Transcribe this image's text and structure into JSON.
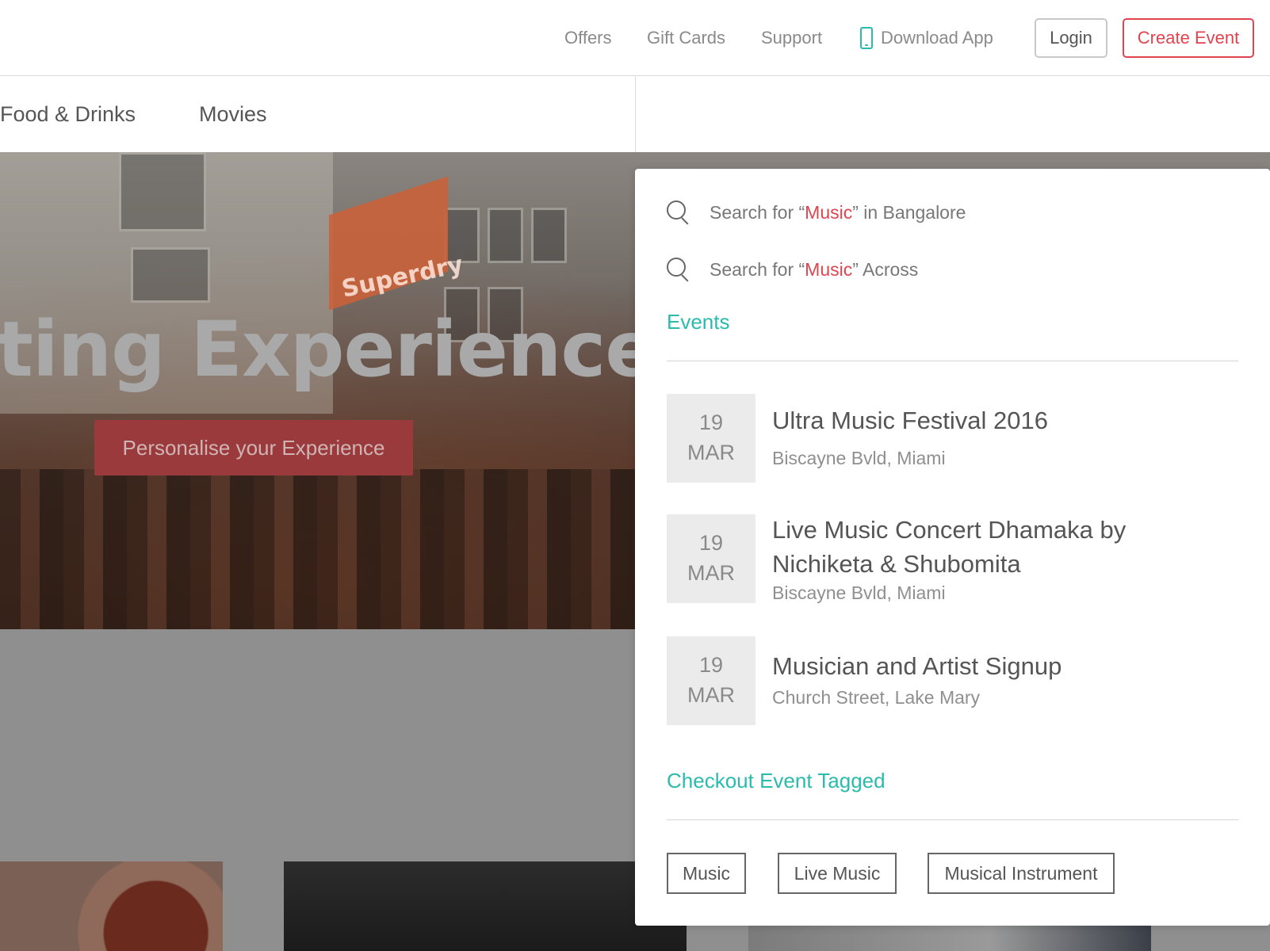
{
  "header": {
    "nav": [
      "Offers",
      "Gift Cards",
      "Support"
    ],
    "download_app": "Download App",
    "login": "Login",
    "create_event": "Create Event"
  },
  "categories": [
    "Food & Drinks",
    "Movies"
  ],
  "hero": {
    "title": "ting Experiences in",
    "flag_text": "Superdry",
    "cta": "Personalise your Experience"
  },
  "search": {
    "query": "Music",
    "row1": {
      "prefix": "Search for “",
      "suffix": "” in Bangalore"
    },
    "row2": {
      "prefix": "Search for “",
      "suffix": "” Across"
    }
  },
  "events_section": {
    "title": "Events",
    "items": [
      {
        "day": "19",
        "month": "MAR",
        "title": "Ultra Music Festival 2016",
        "location": "Biscayne Bvld, Miami"
      },
      {
        "day": "19",
        "month": "MAR",
        "title": "Live Music Concert Dhamaka by Nichiketa & Shubomita",
        "location": "Biscayne Bvld, Miami"
      },
      {
        "day": "19",
        "month": "MAR",
        "title": "Musician and Artist Signup",
        "location": "Church Street, Lake Mary"
      }
    ]
  },
  "tags_section": {
    "title": "Checkout Event Tagged",
    "tags": [
      "Music",
      "Live Music",
      "Musical Instrument"
    ]
  },
  "colors": {
    "accent_red": "#e0444e",
    "accent_teal": "#2bbbad"
  }
}
